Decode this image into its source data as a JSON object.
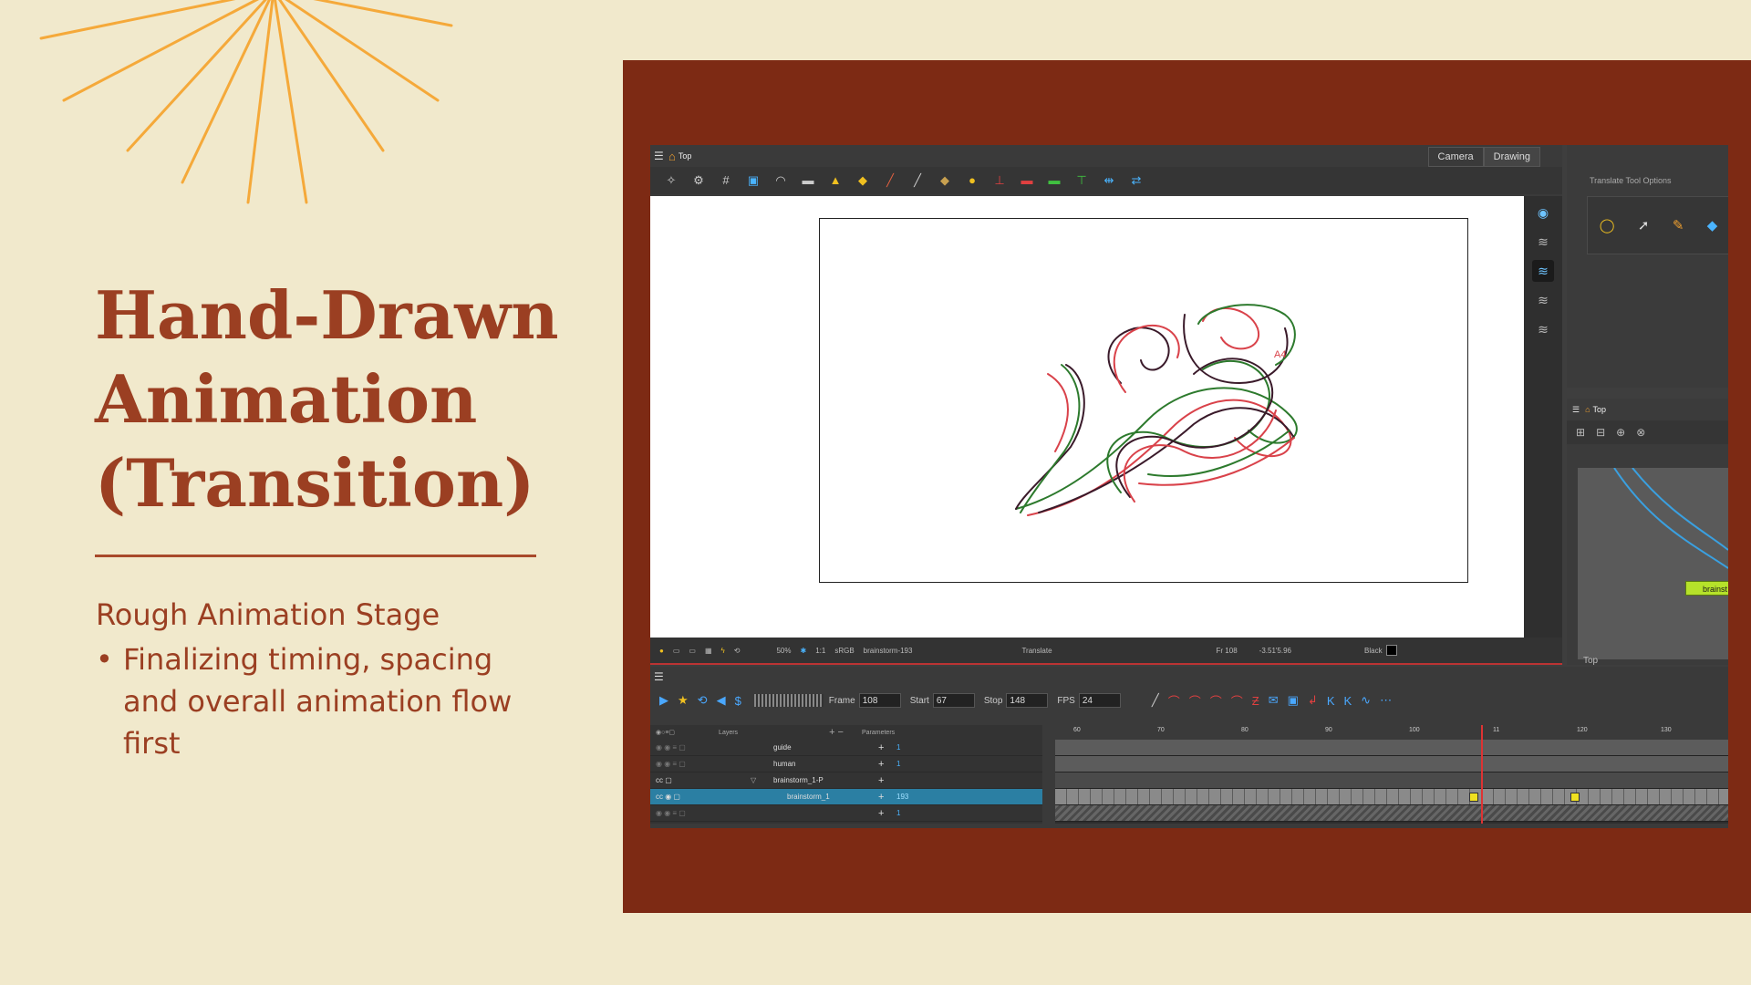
{
  "slide": {
    "title_lines": [
      "Hand-Drawn",
      "Animation",
      "(Transition)"
    ],
    "subtitle": "Rough Animation Stage",
    "bullet": "Finalizing timing, spacing and overall animation flow first",
    "colors": {
      "background": "#f1e9cc",
      "accent": "#9b3f22",
      "frame": "#7d2a14",
      "sun": "#f5a93a"
    }
  },
  "app": {
    "view_title": "Top",
    "tabs": [
      "Camera",
      "Drawing"
    ],
    "view_tools": [
      "lasso-icon",
      "gear-icon",
      "grid-icon",
      "overlay-icon",
      "onion-icon",
      "light-table-icon",
      "lock-icon",
      "lock-all-icon",
      "brush-icon",
      "pencil-icon",
      "bone-icon",
      "bulb-icon",
      "layer-icon",
      "layer-red-icon",
      "layer-green-icon",
      "layer-green2-icon",
      "flip-h-icon",
      "flip-v-icon"
    ],
    "status": {
      "zoom": "50%",
      "ratio": "1:1",
      "color_space": "sRGB",
      "drawing": "brainstorm-193",
      "tool": "Translate",
      "frame": "Fr 108",
      "coords": "-3.51'5.96",
      "color": "Black"
    },
    "tool_options": {
      "title": "Translate Tool Options"
    },
    "node_view": {
      "title": "Top",
      "node_label": "brainst",
      "footer": "Top"
    },
    "timeline": {
      "labels": {
        "frame": "Frame",
        "start": "Start",
        "stop": "Stop",
        "fps": "FPS"
      },
      "frame": "108",
      "start": "67",
      "stop": "148",
      "fps": "24",
      "headers": {
        "layers": "Layers",
        "parameters": "Parameters"
      },
      "ruler": [
        "60",
        "70",
        "80",
        "90",
        "100",
        "11",
        "120",
        "130"
      ],
      "layers": [
        {
          "name": "guide",
          "param": "1"
        },
        {
          "name": "human",
          "param": "1"
        },
        {
          "name": "brainstorm_1-P",
          "param": ""
        },
        {
          "name": "brainstorm_1",
          "param": "193"
        },
        {
          "name": "",
          "param": "1"
        }
      ]
    }
  }
}
